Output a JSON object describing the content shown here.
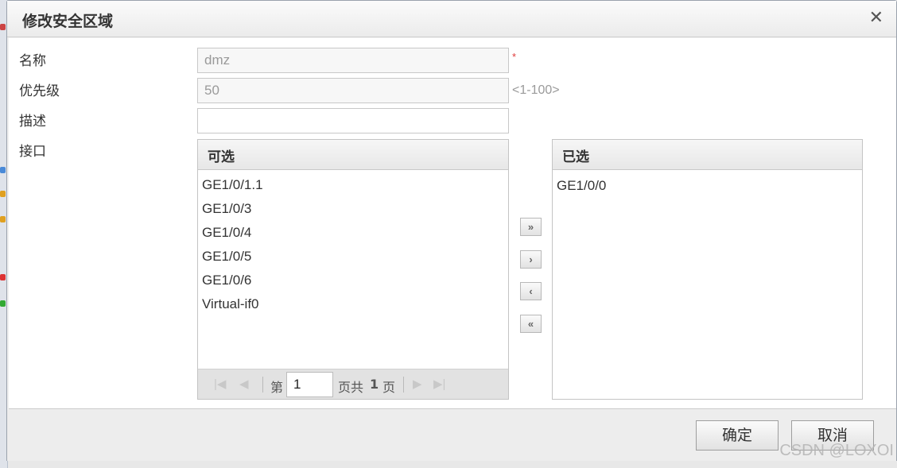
{
  "dialog": {
    "title": "修改安全区域"
  },
  "form": {
    "name_label": "名称",
    "name_value": "dmz",
    "required_mark": "*",
    "priority_label": "优先级",
    "priority_value": "50",
    "priority_hint": "<1-100>",
    "desc_label": "描述",
    "desc_value": "",
    "interface_label": "接口"
  },
  "available": {
    "header": "可选",
    "items": [
      "GE1/0/1.1",
      "GE1/0/3",
      "GE1/0/4",
      "GE1/0/5",
      "GE1/0/6",
      "Virtual-if0"
    ],
    "pager": {
      "prefix": "第",
      "page": "1",
      "suffix_a": "页共",
      "total": "1",
      "suffix_b": "页"
    }
  },
  "selected": {
    "header": "已选",
    "items": [
      "GE1/0/0"
    ]
  },
  "move_buttons": {
    "add_all": "»",
    "add": "›",
    "remove": "‹",
    "remove_all": "«"
  },
  "footer": {
    "ok": "确定",
    "cancel": "取消"
  },
  "watermark": "CSDN @LOXOI",
  "colors": {
    "required": "#e03c3c",
    "hint": "#9a9a9a"
  }
}
